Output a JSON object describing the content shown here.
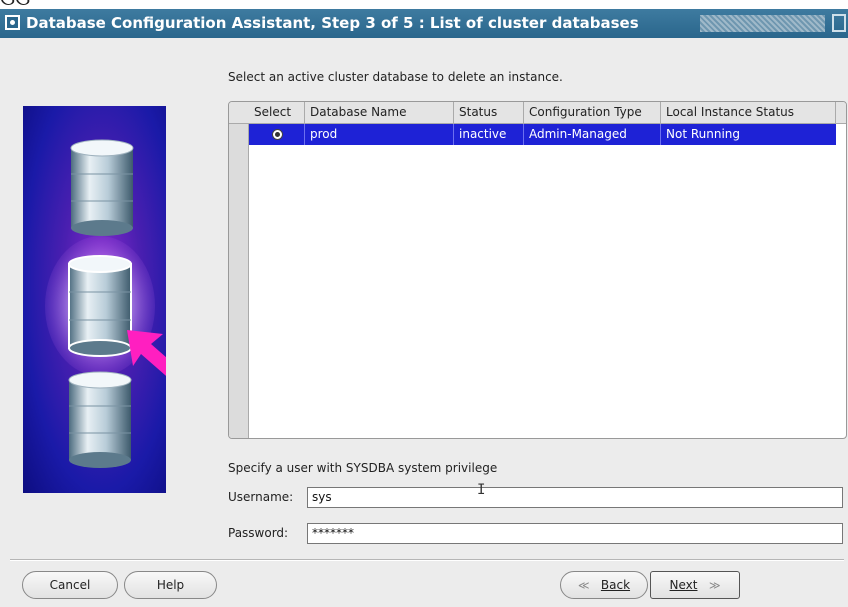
{
  "crop_text": "ଓଓ",
  "window": {
    "title": "Database Configuration Assistant, Step 3 of 5 : List of cluster databases"
  },
  "instruction": "Select an active cluster database to delete an instance.",
  "table": {
    "columns": [
      "Select",
      "Database Name",
      "Status",
      "Configuration Type",
      "Local Instance Status"
    ],
    "rows": [
      {
        "selected": true,
        "database_name": "prod",
        "status": "inactive",
        "configuration_type": "Admin-Managed",
        "local_instance_status": "Not Running"
      }
    ]
  },
  "credentials": {
    "section_label": "Specify a user with SYSDBA system privilege",
    "username_label": "Username:",
    "username_value": "sys",
    "password_label": "Password:",
    "password_value": "*******"
  },
  "buttons": {
    "cancel": "Cancel",
    "help": "Help",
    "back": "Back",
    "next": "Next"
  },
  "colors": {
    "titlebar": "#2a668c",
    "selection": "#1e22d6"
  },
  "icons": {
    "window_icon": "window-menu-icon",
    "maximize": "maximize-icon",
    "back_arrow": "double-chevron-left-icon",
    "next_arrow": "double-chevron-right-icon"
  }
}
